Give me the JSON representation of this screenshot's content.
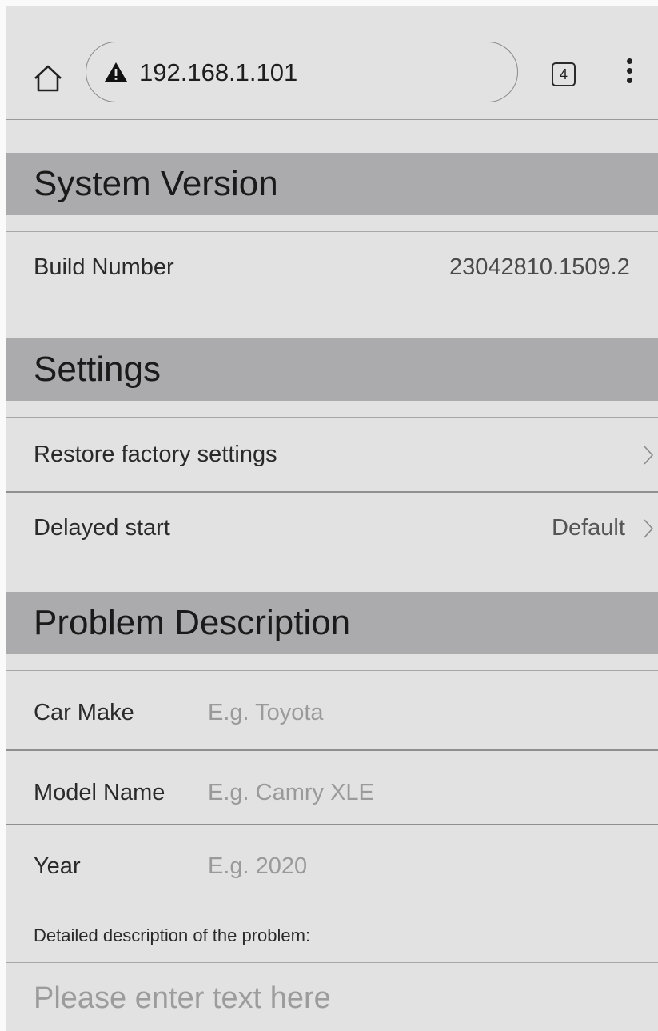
{
  "browser": {
    "url": "192.168.1.101",
    "tab_count": "4"
  },
  "system_version": {
    "title": "System Version",
    "build_label": "Build Number",
    "build_value": "23042810.1509.2"
  },
  "settings": {
    "title": "Settings",
    "restore_label": "Restore factory settings",
    "delayed_label": "Delayed start",
    "delayed_value": "Default"
  },
  "problem": {
    "title": "Problem Description",
    "car_make_label": "Car Make",
    "car_make_placeholder": "E.g. Toyota",
    "model_label": "Model Name",
    "model_placeholder": "E.g. Camry XLE",
    "year_label": "Year",
    "year_placeholder": "E.g. 2020",
    "description_label": "Detailed description of the problem:",
    "description_placeholder": "Please enter text here"
  }
}
